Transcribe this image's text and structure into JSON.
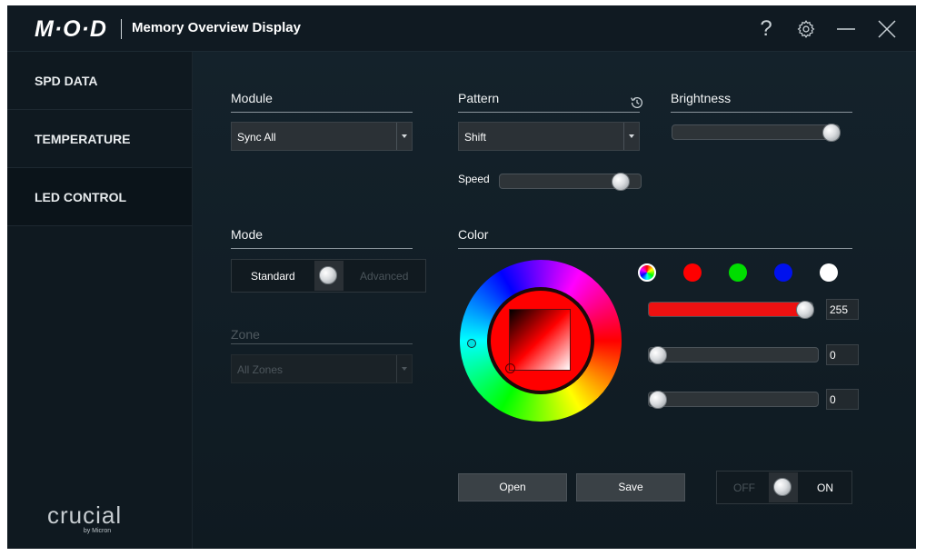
{
  "app": {
    "logo": "M·O·D",
    "title": "Memory Overview Display"
  },
  "titlebar": {
    "help_label": "?"
  },
  "sidebar": {
    "items": [
      {
        "label": "SPD DATA"
      },
      {
        "label": "TEMPERATURE"
      },
      {
        "label": "LED CONTROL",
        "active": true
      }
    ],
    "brand": {
      "name": "crucial",
      "sub": "by Micron"
    }
  },
  "module": {
    "label": "Module",
    "value": "Sync All"
  },
  "pattern": {
    "label": "Pattern",
    "value": "Shift",
    "speed_label": "Speed",
    "speed_level": 0.9
  },
  "brightness": {
    "label": "Brightness",
    "level": 1.0
  },
  "mode": {
    "label": "Mode",
    "standard_label": "Standard",
    "advanced_label": "Advanced",
    "selected": "Standard"
  },
  "zone": {
    "label": "Zone",
    "value": "All Zones"
  },
  "color": {
    "label": "Color",
    "presets": [
      "rainbow",
      "#ff0000",
      "#00dd00",
      "#0011ee",
      "#ffffff"
    ],
    "r": "255",
    "g": "0",
    "b": "0",
    "selected_hex": "#ff0000"
  },
  "actions": {
    "open_label": "Open",
    "save_label": "Save"
  },
  "power": {
    "off_label": "OFF",
    "on_label": "ON",
    "state": "ON"
  }
}
